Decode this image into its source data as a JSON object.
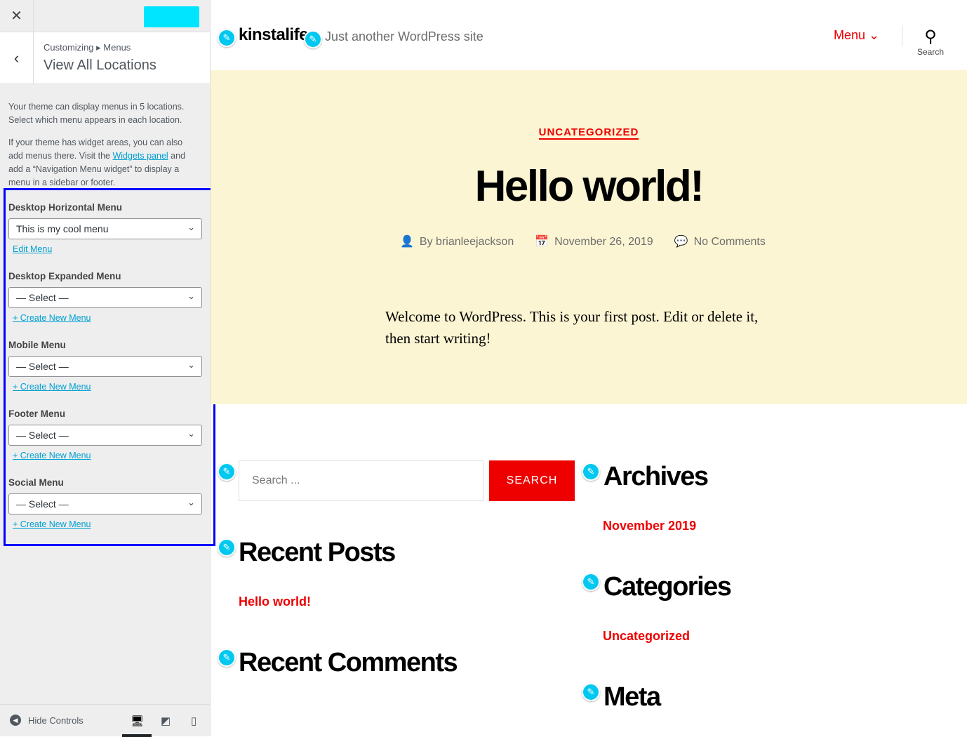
{
  "sidebar": {
    "close_icon": "close-icon",
    "breadcrumb": "Customizing ▸ Menus",
    "title": "View All Locations",
    "desc1": "Your theme can display menus in 5 locations. Select which menu appears in each location.",
    "desc2_a": "If your theme has widget areas, you can also add menus there. Visit the ",
    "desc2_link": "Widgets panel",
    "desc2_b": " and add a “Navigation Menu widget” to display a menu in a sidebar or footer.",
    "locations": [
      {
        "label": "Desktop Horizontal Menu",
        "value": "This is my cool menu",
        "link": "Edit Menu"
      },
      {
        "label": "Desktop Expanded Menu",
        "value": "— Select —",
        "link": "+ Create New Menu"
      },
      {
        "label": "Mobile Menu",
        "value": "— Select —",
        "link": "+ Create New Menu"
      },
      {
        "label": "Footer Menu",
        "value": "— Select —",
        "link": "+ Create New Menu"
      },
      {
        "label": "Social Menu",
        "value": "— Select —",
        "link": "+ Create New Menu"
      }
    ],
    "hide_controls": "Hide Controls"
  },
  "preview": {
    "site_title": "kinstalife",
    "tagline": "Just another WordPress site",
    "menu": "Menu",
    "search_label": "Search",
    "category": "UNCATEGORIZED",
    "post_title": "Hello world!",
    "author": "By brianleejackson",
    "date": "November 26, 2019",
    "comments": "No Comments",
    "body": "Welcome to WordPress. This is your first post. Edit or delete it, then start writing!",
    "search_placeholder": "Search ...",
    "search_button": "SEARCH",
    "recent_posts": "Recent Posts",
    "recent_post_item": "Hello world!",
    "recent_comments": "Recent Comments",
    "archives": "Archives",
    "archive_item": "November 2019",
    "categories": "Categories",
    "category_item": "Uncategorized",
    "meta": "Meta"
  },
  "colors": {
    "accent": "#e00000",
    "publish": "#00e5ff",
    "highlight": "#0000ff",
    "hero_bg": "#fcf5d3"
  }
}
